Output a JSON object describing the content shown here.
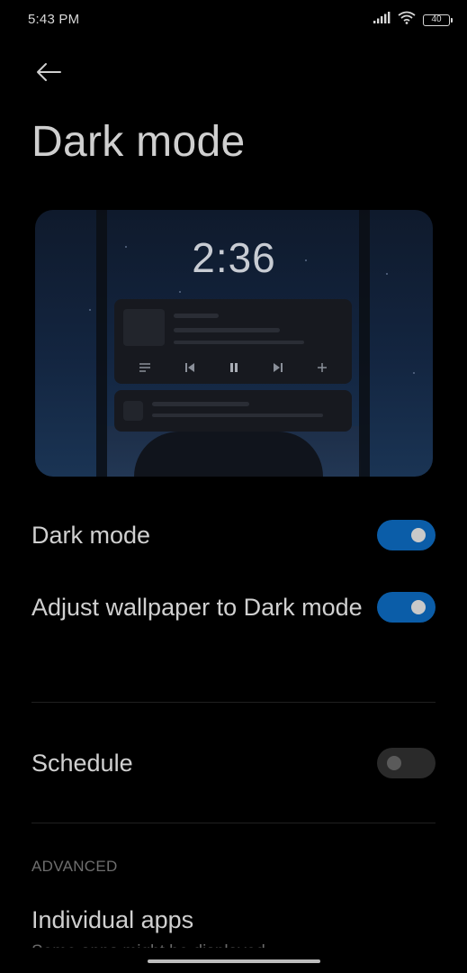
{
  "status_bar": {
    "time": "5:43 PM",
    "battery": "40",
    "icons": [
      "signal-icon",
      "wifi-icon",
      "battery-icon"
    ]
  },
  "header": {
    "back_icon": "arrow-left-icon",
    "title": "Dark mode"
  },
  "preview": {
    "clock": "2:36",
    "media_icons": [
      "playlist-icon",
      "skip-previous-icon",
      "pause-icon",
      "skip-next-icon",
      "plus-icon"
    ]
  },
  "settings": [
    {
      "label": "Dark mode",
      "enabled": true
    },
    {
      "label": "Adjust wallpaper to Dark mode",
      "enabled": true
    },
    {
      "label": "Schedule",
      "enabled": false
    }
  ],
  "advanced": {
    "header": "ADVANCED",
    "items": [
      {
        "title": "Individual apps",
        "subtitle": "Some apps might be displayed"
      }
    ]
  },
  "colors": {
    "background": "#000000",
    "toggle_on": "#0b5da8",
    "toggle_off": "#2a2a2a",
    "text_primary": "#d0d0d0",
    "text_secondary": "#6e6e6e"
  }
}
